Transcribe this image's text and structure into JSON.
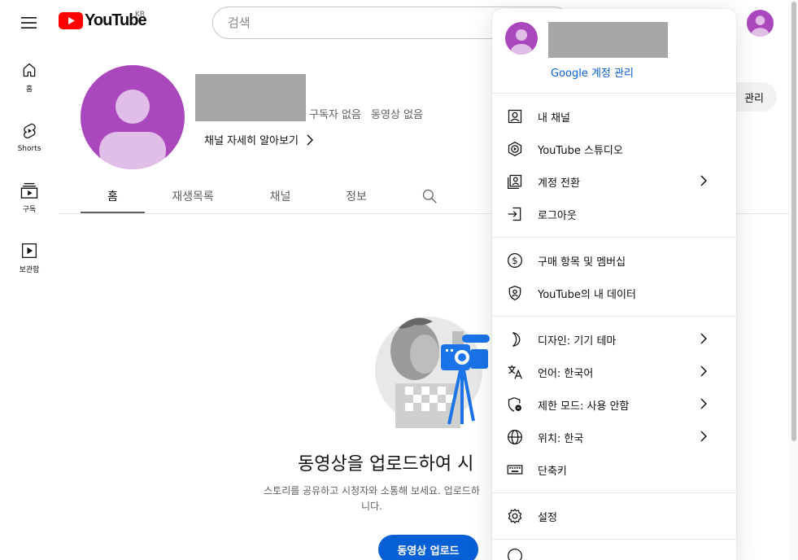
{
  "header": {
    "logo_text": "YouTube",
    "country_code": "KR",
    "search_placeholder": "검색"
  },
  "guide": {
    "items": [
      {
        "label": "홈",
        "icon": "home-icon"
      },
      {
        "label": "Shorts",
        "icon": "shorts-icon"
      },
      {
        "label": "구독",
        "icon": "subscriptions-icon"
      },
      {
        "label": "보관함",
        "icon": "library-icon"
      }
    ]
  },
  "channel": {
    "subscribers": "구독자 없음",
    "videos": "동영상 없음",
    "more_link": "채널 자세히 알아보기",
    "manage_button": "관리",
    "tabs": [
      "홈",
      "재생목록",
      "채널",
      "정보"
    ],
    "active_tab": "홈"
  },
  "empty_state": {
    "title": "동영상을 업로드하여 시",
    "subtitle_line1": "스토리를 공유하고 시청자와 소통해 보세요. 업로드하",
    "subtitle_line2": "니다.",
    "upload_button": "동영상 업로드"
  },
  "account_menu": {
    "manage_account": "Google 계정 관리",
    "sections": [
      [
        {
          "label": "내 채널",
          "icon": "account-box-icon",
          "chevron": false
        },
        {
          "label": "YouTube 스튜디오",
          "icon": "studio-icon",
          "chevron": false
        },
        {
          "label": "계정 전환",
          "icon": "switch-account-icon",
          "chevron": true
        },
        {
          "label": "로그아웃",
          "icon": "sign-out-icon",
          "chevron": false
        }
      ],
      [
        {
          "label": "구매 항목 및 멤버십",
          "icon": "dollar-icon",
          "chevron": false
        },
        {
          "label": "YouTube의 내 데이터",
          "icon": "shield-person-icon",
          "chevron": false
        }
      ],
      [
        {
          "label": "디자인: 기기 테마",
          "icon": "moon-icon",
          "chevron": true
        },
        {
          "label": "언어: 한국어",
          "icon": "translate-icon",
          "chevron": true
        },
        {
          "label": "제한 모드: 사용 안함",
          "icon": "restricted-shield-icon",
          "chevron": true
        },
        {
          "label": "위치: 한국",
          "icon": "globe-icon",
          "chevron": true
        },
        {
          "label": "단축키",
          "icon": "keyboard-icon",
          "chevron": false
        }
      ],
      [
        {
          "label": "설정",
          "icon": "gear-icon",
          "chevron": false
        }
      ]
    ]
  },
  "colors": {
    "brand_red": "#ff0000",
    "link_blue": "#065fd4",
    "avatar_purple": "#ab47bc",
    "avatar_light": "#e1bee7"
  }
}
